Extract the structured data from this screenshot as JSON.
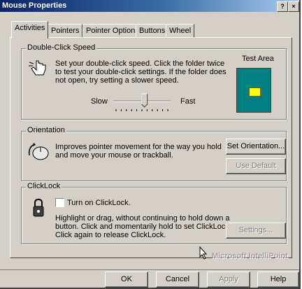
{
  "window": {
    "title": "Mouse Properties",
    "help_glyph": "?",
    "close_glyph": "×"
  },
  "tabs": [
    {
      "label": "Activities"
    },
    {
      "label": "Pointers"
    },
    {
      "label": "Pointer Options"
    },
    {
      "label": "Buttons"
    },
    {
      "label": "Wheel"
    }
  ],
  "double_click": {
    "legend": "Double-Click Speed",
    "desc_line1": "Set your double-click speed.  Click the folder twice",
    "desc_line2": "to test your double-click settings.  If the folder does",
    "desc_line3": "not open, try setting a slower speed.",
    "test_area_label": "Test Area",
    "slow_label": "Slow",
    "fast_label": "Fast",
    "speed_level": 0.55
  },
  "orientation": {
    "legend": "Orientation",
    "desc_line1": "Improves pointer movement for the way you hold",
    "desc_line2": "and move your mouse or trackball.",
    "set_button": "Set Orientation...",
    "default_button": "Use Default"
  },
  "clicklock": {
    "legend": "ClickLock",
    "checkbox_label": "Turn on ClickLock.",
    "checked": false,
    "desc_line1": "Highlight or drag, without continuing to hold down a",
    "desc_line2": "button.  Click and momentarily hold to set ClickLock.",
    "desc_line3": "Click again to release ClickLock.",
    "settings_button": "Settings..."
  },
  "branding": {
    "text": "Microsoft IntelliPoint"
  },
  "footer": {
    "ok": "OK",
    "cancel": "Cancel",
    "apply": "Apply",
    "help": "Help"
  },
  "colors": {
    "titlebar": "#0a246a",
    "face": "#d4d0c8",
    "test_area": "#008080",
    "folder": "#ffff00"
  }
}
